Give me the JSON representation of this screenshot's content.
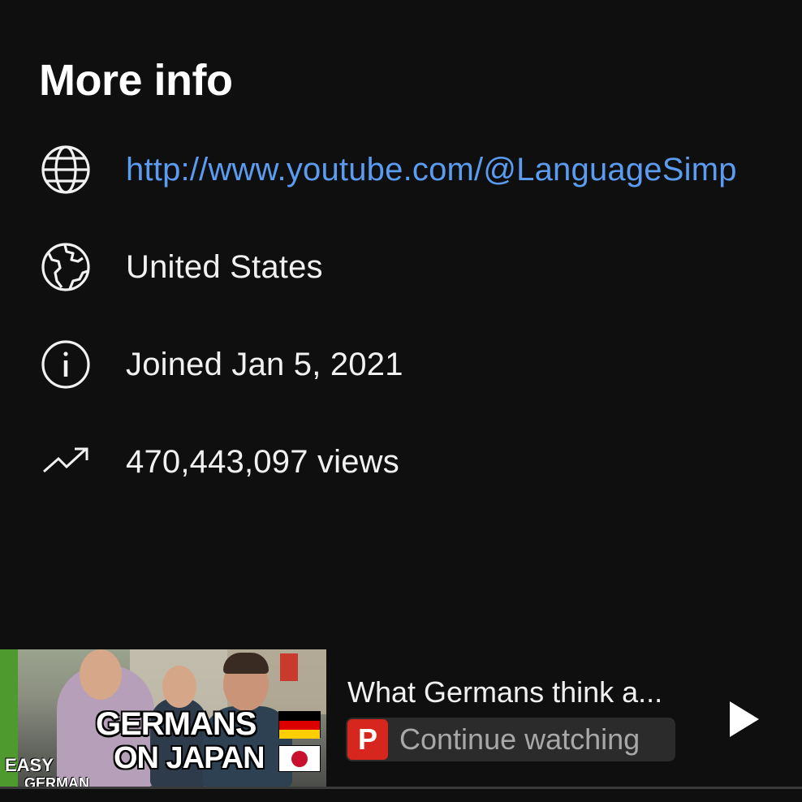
{
  "section": {
    "title": "More info"
  },
  "info": {
    "link": "http://www.youtube.com/@LanguageSimp",
    "country": "United States",
    "joined": "Joined Jan 5, 2021",
    "views": "470,443,097 views"
  },
  "icons": {
    "link": "globe-icon",
    "country": "earth-icon",
    "joined": "info-icon",
    "views": "trending-up-icon",
    "play": "play-icon"
  },
  "miniplayer": {
    "video_title": "What Germans think a...",
    "continue_label": "Continue watching",
    "app_badge_letter": "P",
    "thumbnail": {
      "line1": "GERMANS",
      "line2": "ON JAPAN",
      "brand_line1": "EASY",
      "brand_line2": "GERMAN"
    }
  },
  "colors": {
    "background": "#0f0f0f",
    "link": "#5b9cf0",
    "text": "#f1f1f1",
    "badge_red": "#d7261e"
  }
}
